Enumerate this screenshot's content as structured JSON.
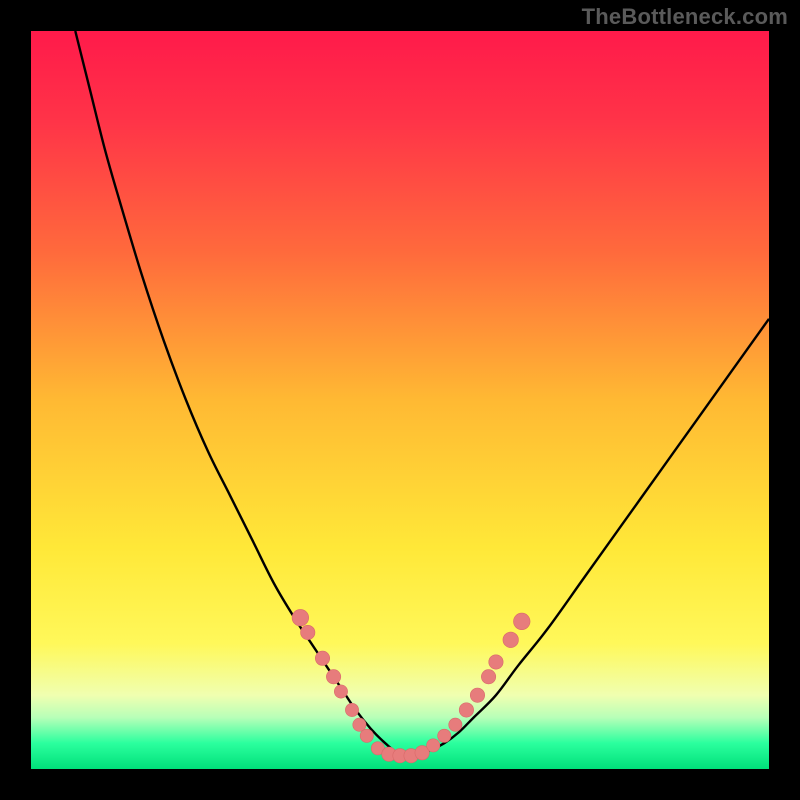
{
  "watermark": "TheBottleneck.com",
  "colors": {
    "frame": "#000000",
    "gradient_stops": [
      {
        "offset": 0.0,
        "color": "#ff1a4a"
      },
      {
        "offset": 0.12,
        "color": "#ff3348"
      },
      {
        "offset": 0.3,
        "color": "#ff6a3c"
      },
      {
        "offset": 0.5,
        "color": "#ffb933"
      },
      {
        "offset": 0.7,
        "color": "#ffe838"
      },
      {
        "offset": 0.83,
        "color": "#fff85a"
      },
      {
        "offset": 0.9,
        "color": "#f0ffb0"
      },
      {
        "offset": 0.93,
        "color": "#b8ffb8"
      },
      {
        "offset": 0.965,
        "color": "#2bff9e"
      },
      {
        "offset": 1.0,
        "color": "#00e07a"
      }
    ],
    "curve": "#000000",
    "marker_fill": "#e77c7c",
    "marker_stroke": "#d96a6a"
  },
  "chart_data": {
    "type": "line",
    "title": "",
    "xlabel": "",
    "ylabel": "",
    "xlim": [
      0,
      100
    ],
    "ylim": [
      0,
      100
    ],
    "series": [
      {
        "name": "bottleneck-curve",
        "x": [
          6,
          8,
          10,
          12,
          15,
          18,
          21,
          24,
          27,
          30,
          33,
          36,
          38,
          40,
          42,
          44,
          46,
          48,
          50,
          52,
          54,
          56,
          58,
          60,
          63,
          66,
          70,
          75,
          80,
          85,
          90,
          95,
          100
        ],
        "y": [
          100,
          92,
          84,
          77,
          67,
          58,
          50,
          43,
          37,
          31,
          25,
          20,
          17,
          14,
          11,
          8,
          5.5,
          3.5,
          2,
          2,
          2.5,
          3.5,
          5,
          7,
          10,
          14,
          19,
          26,
          33,
          40,
          47,
          54,
          61
        ]
      }
    ],
    "markers": [
      {
        "x": 36.5,
        "y": 20.5,
        "r": 1.5
      },
      {
        "x": 37.5,
        "y": 18.5,
        "r": 1.3
      },
      {
        "x": 39.5,
        "y": 15.0,
        "r": 1.3
      },
      {
        "x": 41.0,
        "y": 12.5,
        "r": 1.3
      },
      {
        "x": 42.0,
        "y": 10.5,
        "r": 1.2
      },
      {
        "x": 43.5,
        "y": 8.0,
        "r": 1.2
      },
      {
        "x": 44.5,
        "y": 6.0,
        "r": 1.2
      },
      {
        "x": 45.5,
        "y": 4.5,
        "r": 1.2
      },
      {
        "x": 47.0,
        "y": 2.8,
        "r": 1.2
      },
      {
        "x": 48.5,
        "y": 2.0,
        "r": 1.3
      },
      {
        "x": 50.0,
        "y": 1.8,
        "r": 1.3
      },
      {
        "x": 51.5,
        "y": 1.8,
        "r": 1.3
      },
      {
        "x": 53.0,
        "y": 2.2,
        "r": 1.3
      },
      {
        "x": 54.5,
        "y": 3.2,
        "r": 1.2
      },
      {
        "x": 56.0,
        "y": 4.5,
        "r": 1.2
      },
      {
        "x": 57.5,
        "y": 6.0,
        "r": 1.2
      },
      {
        "x": 59.0,
        "y": 8.0,
        "r": 1.3
      },
      {
        "x": 60.5,
        "y": 10.0,
        "r": 1.3
      },
      {
        "x": 62.0,
        "y": 12.5,
        "r": 1.3
      },
      {
        "x": 63.0,
        "y": 14.5,
        "r": 1.3
      },
      {
        "x": 65.0,
        "y": 17.5,
        "r": 1.4
      },
      {
        "x": 66.5,
        "y": 20.0,
        "r": 1.5
      }
    ]
  }
}
